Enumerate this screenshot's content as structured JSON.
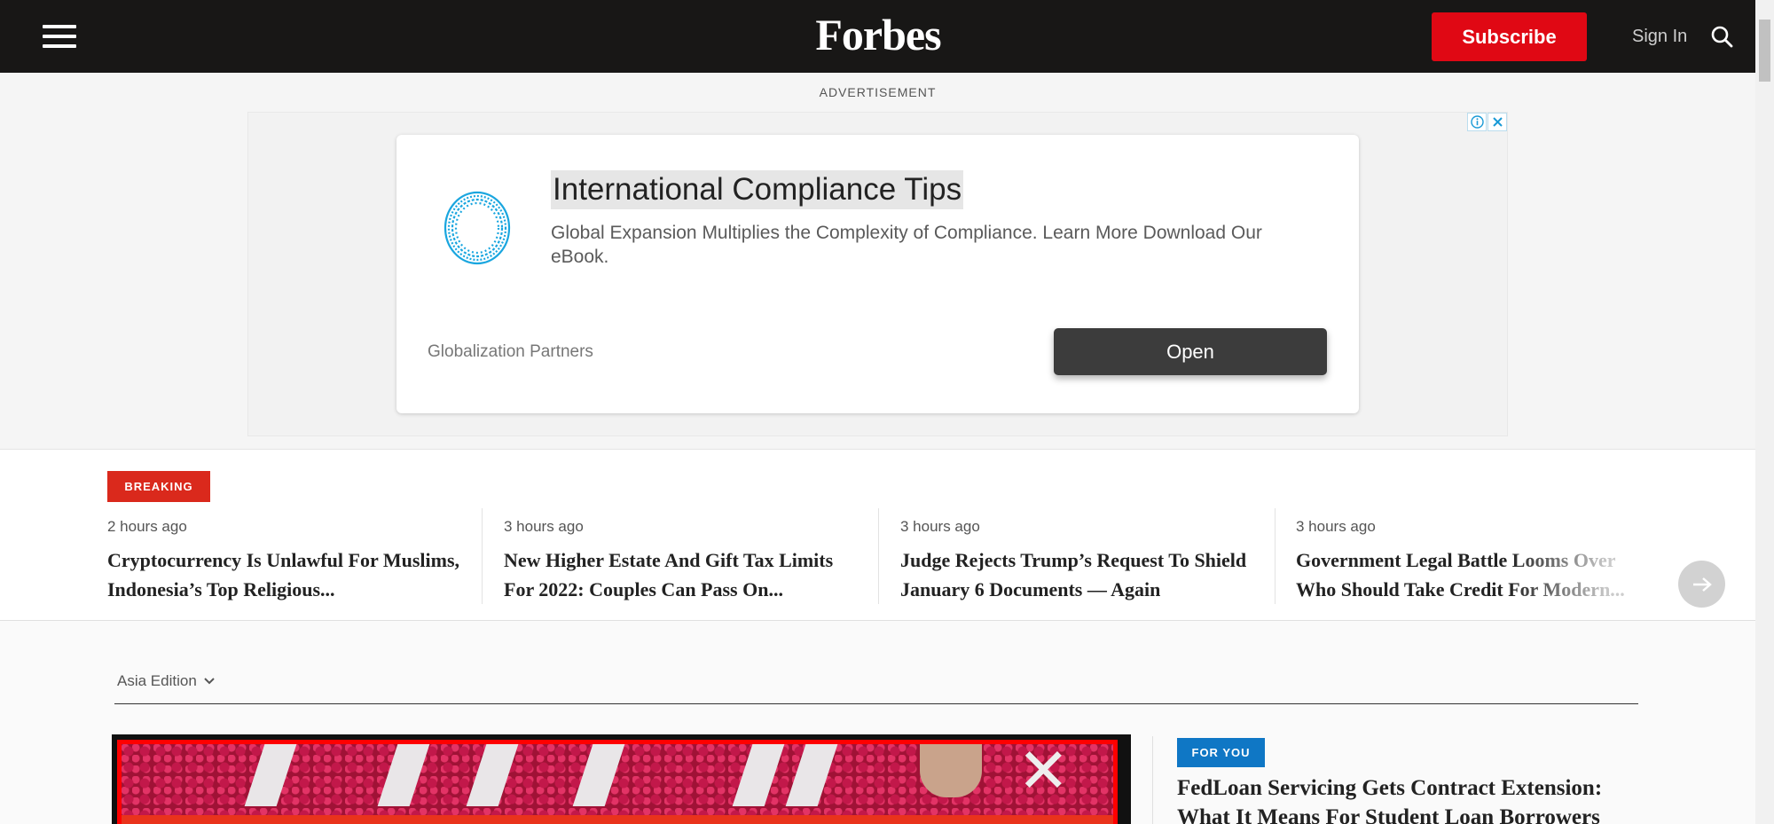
{
  "header": {
    "logo": "Forbes",
    "subscribe_label": "Subscribe",
    "signin_label": "Sign In"
  },
  "ad": {
    "label": "ADVERTISEMENT",
    "title": "International Compliance Tips",
    "description": "Global Expansion Multiplies the Complexity of Compliance. Learn More Download Our eBook.",
    "sponsor": "Globalization Partners",
    "open_label": "Open"
  },
  "breaking": {
    "badge": "BREAKING",
    "stories": [
      {
        "time": "2 hours ago",
        "title": "Cryptocurrency Is Unlawful For Muslims, Indonesia’s Top Religious..."
      },
      {
        "time": "3 hours ago",
        "title": "New Higher Estate And Gift Tax Limits For 2022: Couples Can Pass On..."
      },
      {
        "time": "3 hours ago",
        "title": "Judge Rejects Trump’s Request To Shield January 6 Documents — Again"
      },
      {
        "time": "3 hours ago",
        "title": "Government Legal Battle Looms Over Who Should Take Credit For Modern..."
      }
    ]
  },
  "main": {
    "edition_label": "Asia Edition",
    "for_you_badge": "FOR YOU",
    "for_you_title": "FedLoan Servicing Gets Contract Extension: What It Means For Student Loan Borrowers"
  },
  "colors": {
    "header_bg": "#181716",
    "subscribe_red": "#e00814",
    "breaking_red": "#da291c",
    "for_you_blue": "#0f77c5"
  },
  "icons": [
    "hamburger-menu-icon",
    "search-icon",
    "ad-info-icon",
    "ad-close-icon",
    "arrow-right-icon",
    "chevron-down-icon"
  ]
}
